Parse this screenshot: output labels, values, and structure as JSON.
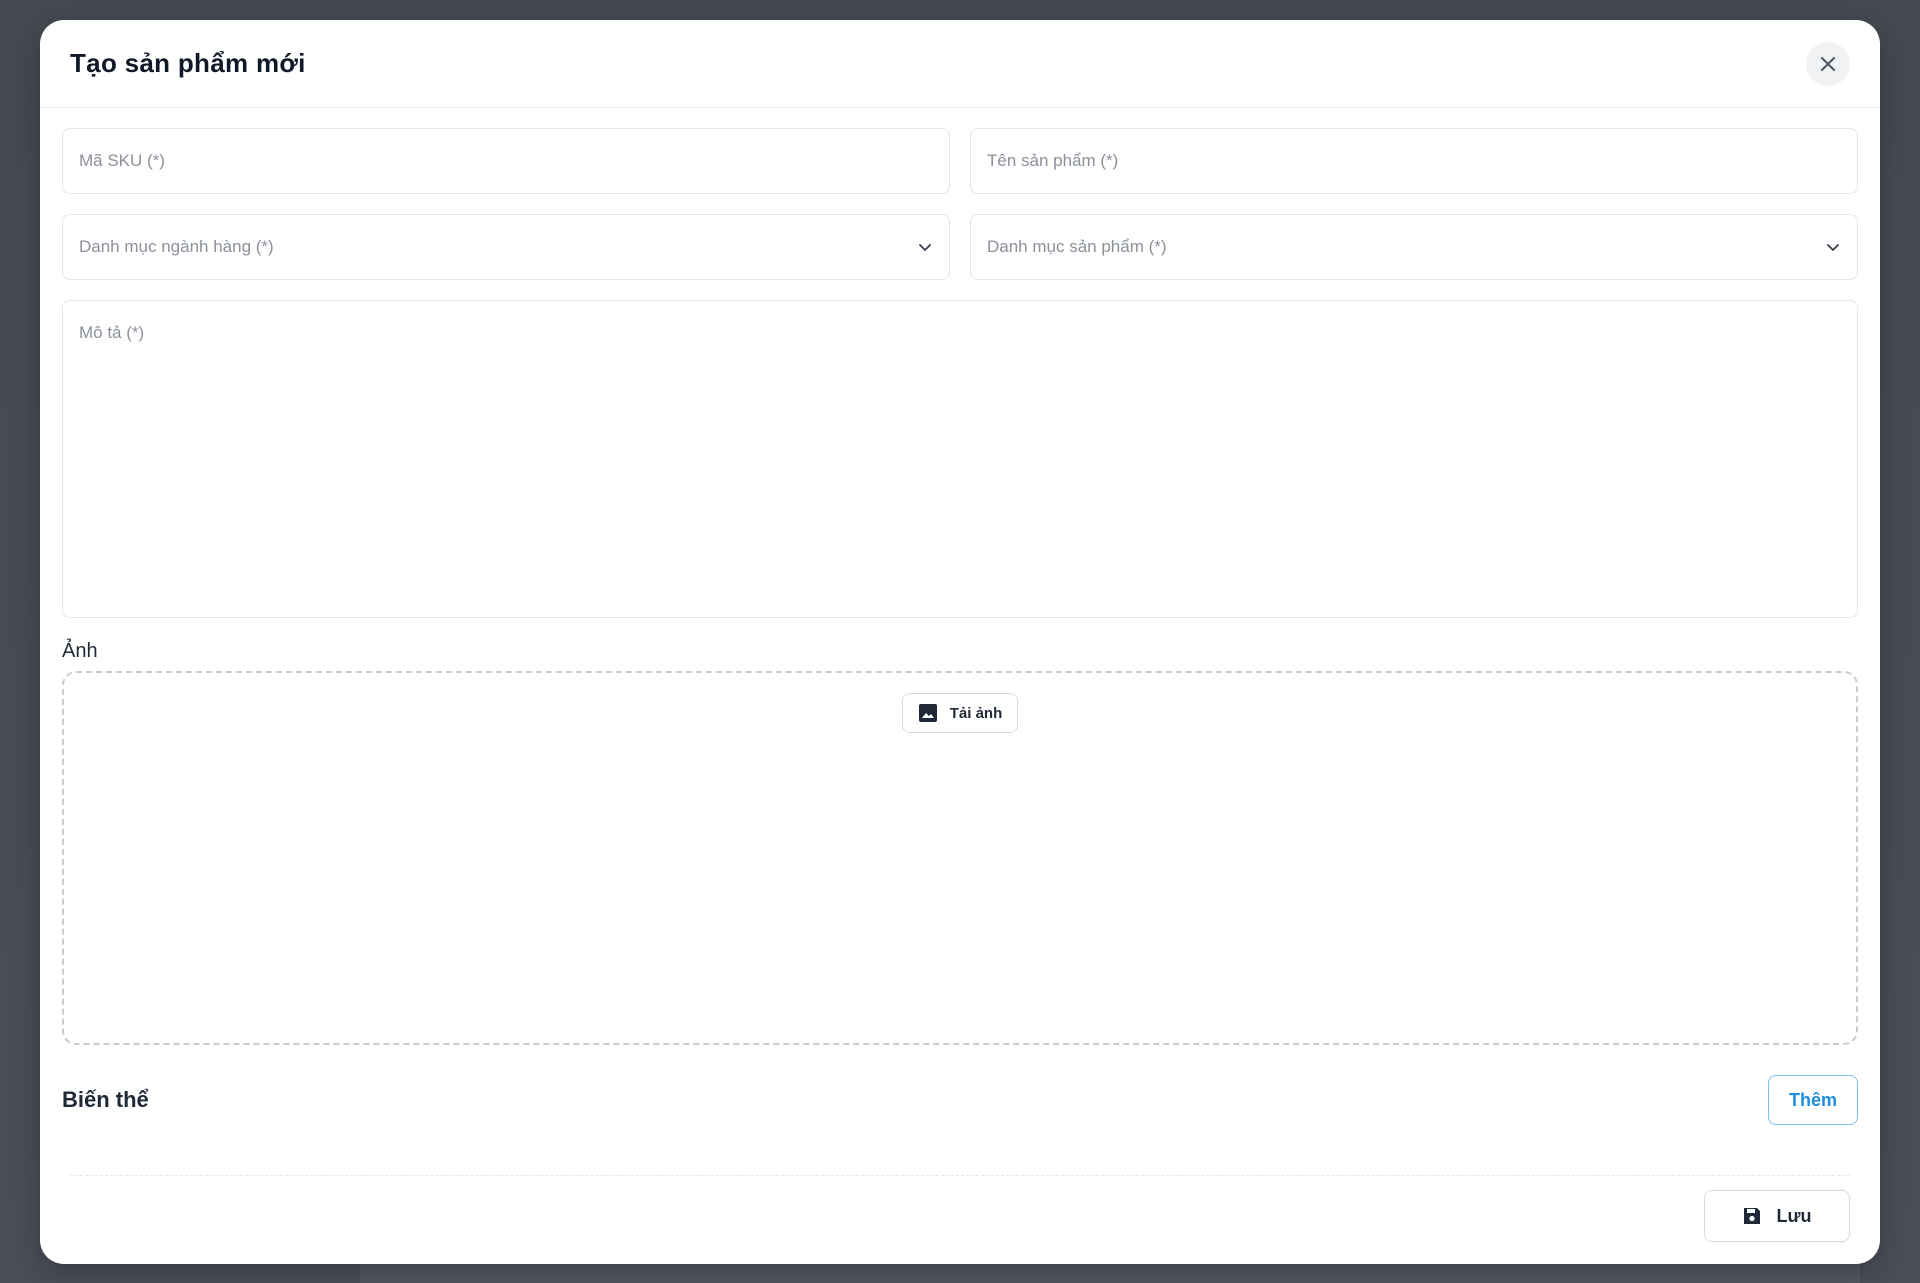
{
  "modal": {
    "title": "Tạo sản phẩm mới"
  },
  "form": {
    "sku_placeholder": "Mã SKU (*)",
    "name_placeholder": "Tên sản phẩm (*)",
    "industry_category_placeholder": "Danh mục ngành hàng (*)",
    "product_category_placeholder": "Danh mục sản phẩm (*)",
    "description_placeholder": "Mô tả (*)"
  },
  "images": {
    "label": "Ảnh",
    "upload_label": "Tải ảnh"
  },
  "variants": {
    "title": "Biến thể",
    "add_label": "Thêm"
  },
  "footer": {
    "save_label": "Lưu"
  },
  "colors": {
    "accent": "#1d8ee0",
    "accent_border": "#7cc0ef",
    "overlay": "#4a4e56"
  },
  "icons": {
    "close": "close-icon",
    "chevron": "chevron-down-icon",
    "image": "image-icon",
    "save": "floppy-disk-icon"
  }
}
